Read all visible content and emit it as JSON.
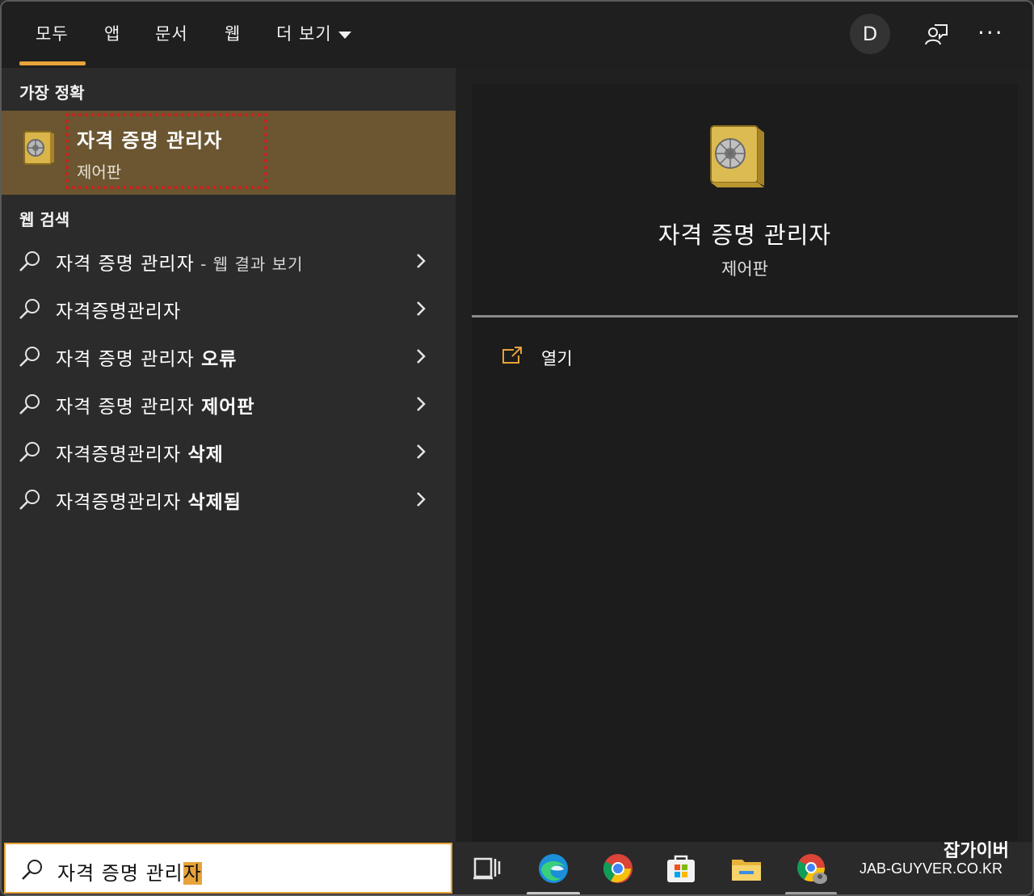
{
  "tabs": [
    {
      "label": "모두"
    },
    {
      "label": "앱"
    },
    {
      "label": "문서"
    },
    {
      "label": "웹"
    },
    {
      "label": "더 보기"
    }
  ],
  "header": {
    "avatar_initial": "D",
    "feedback_icon": "feedback-icon",
    "more_icon": "ellipsis-icon"
  },
  "best_match": {
    "section_label": "가장 정확",
    "title": "자격 증명 관리자",
    "subtitle": "제어판",
    "icon": "safe-icon"
  },
  "web_search": {
    "section_label": "웹 검색",
    "rows": [
      {
        "plain": "자격 증명 관리자",
        "bold": "",
        "suffix": " - 웹 결과 보기"
      },
      {
        "plain": "자격증명관리자",
        "bold": "",
        "suffix": ""
      },
      {
        "plain": "자격 증명 관리자 ",
        "bold": "오류",
        "suffix": ""
      },
      {
        "plain": "자격 증명 관리자 ",
        "bold": "제어판",
        "suffix": ""
      },
      {
        "plain": "자격증명관리자 ",
        "bold": "삭제",
        "suffix": ""
      },
      {
        "plain": "자격증명관리자 ",
        "bold": "삭제됨",
        "suffix": ""
      }
    ]
  },
  "detail": {
    "title": "자격 증명 관리자",
    "subtitle": "제어판",
    "actions": [
      {
        "label": "열기",
        "icon": "open-icon"
      }
    ]
  },
  "taskbar": {
    "search_text_typed": "자격 증명 관리",
    "search_text_selected": "자",
    "icons": [
      "task-view-icon",
      "edge-icon",
      "chrome-icon",
      "store-icon",
      "file-explorer-icon",
      "chrome-profile-icon"
    ]
  },
  "watermark": {
    "korean": "잡가이버",
    "english": "JAB-GUYVER.CO.KR"
  },
  "colors": {
    "accent": "#e8a33a",
    "selected_row": "#6b5631",
    "highlight_box": "#d11f1f"
  }
}
